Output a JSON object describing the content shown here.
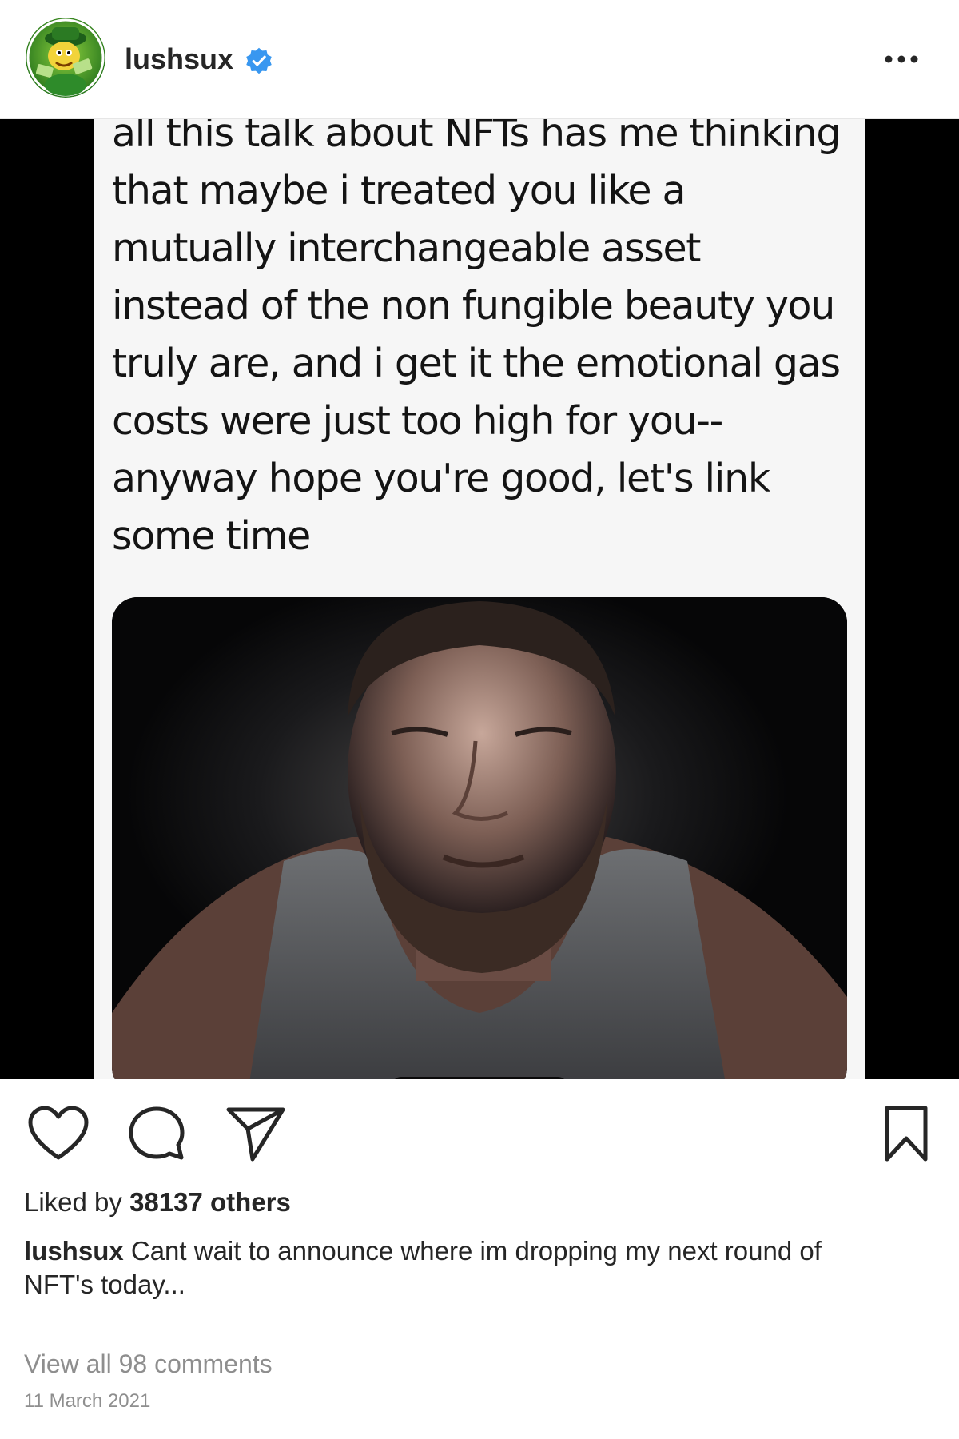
{
  "header": {
    "username": "lushsux",
    "verified": true,
    "avatar_icon": "cartoon-character-avatar",
    "more_icon": "more-dots-icon"
  },
  "post": {
    "tweet_text": "all this talk about NFTs has me thinking that maybe i treated you like a mutually interchangeable asset instead of the non fungible beauty you truly are, and i get it the emotional gas costs were just too high for you-- anyway hope you're good, let's link some time"
  },
  "actions": {
    "like_icon": "heart-icon",
    "comment_icon": "comment-icon",
    "share_icon": "share-icon",
    "save_icon": "bookmark-icon"
  },
  "likes": {
    "prefix": "Liked by ",
    "count_text": "38137 others"
  },
  "caption": {
    "username": "lushsux",
    "text": " Cant wait to announce where im dropping my next round of NFT's today..."
  },
  "comments": {
    "view_all": "View all 98 comments"
  },
  "date": "11 March 2021",
  "colors": {
    "verified_badge": "#3897f0",
    "text_primary": "#262626",
    "text_secondary": "#8e8e8e",
    "media_background": "#000000"
  }
}
